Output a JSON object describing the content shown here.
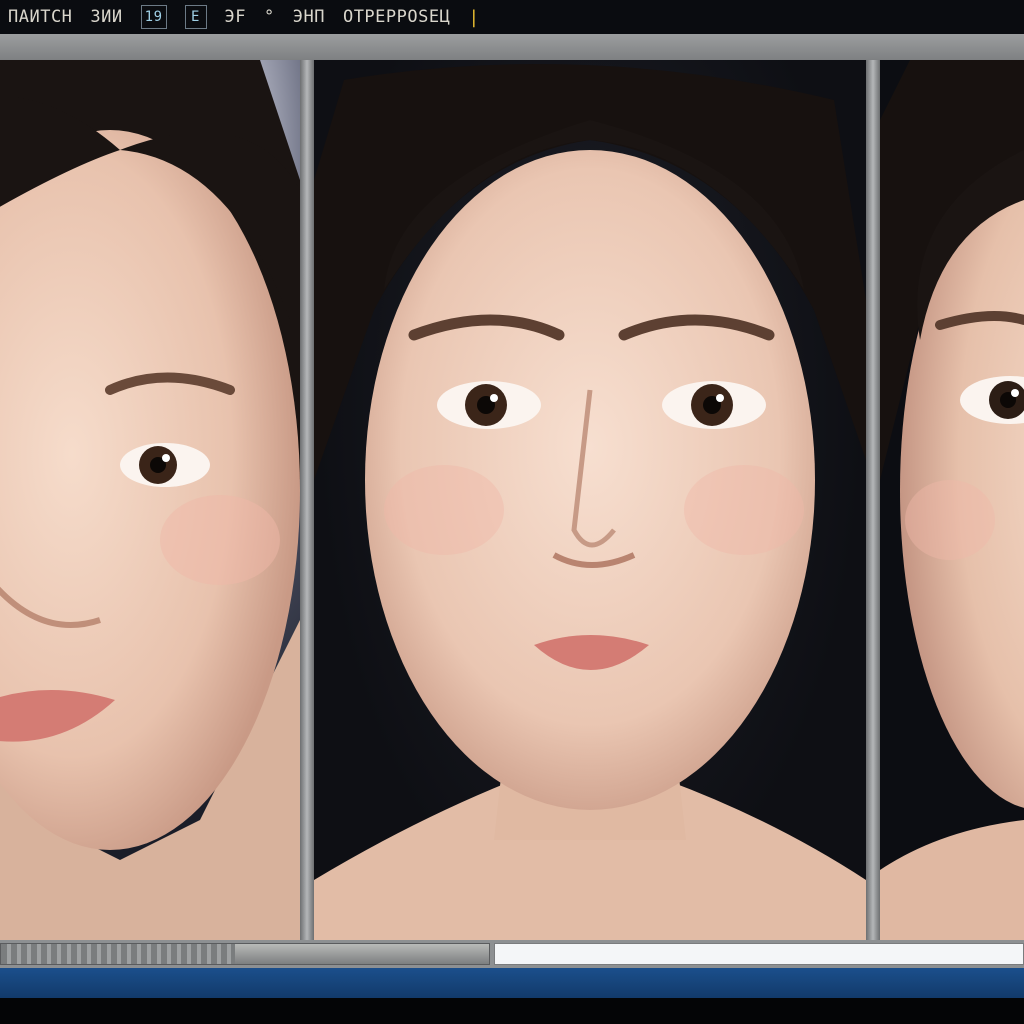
{
  "app": {
    "menu": [
      "ПАИТСН",
      "ЗИИ",
      "ЭНП",
      "ОТРЕРРОSEЦ"
    ],
    "tools": [
      "19",
      "E",
      "ЭF",
      "°"
    ],
    "caret": "|"
  },
  "viewer": {
    "panels": [
      {
        "name": "portrait-left"
      },
      {
        "name": "portrait-center"
      },
      {
        "name": "portrait-right"
      }
    ]
  },
  "status": {
    "progress": 0.48
  },
  "colors": {
    "skin": "#f0d2c0",
    "hair": "#1a1412",
    "lips": "#d47c74",
    "taskbar": "#1b4f8c"
  }
}
